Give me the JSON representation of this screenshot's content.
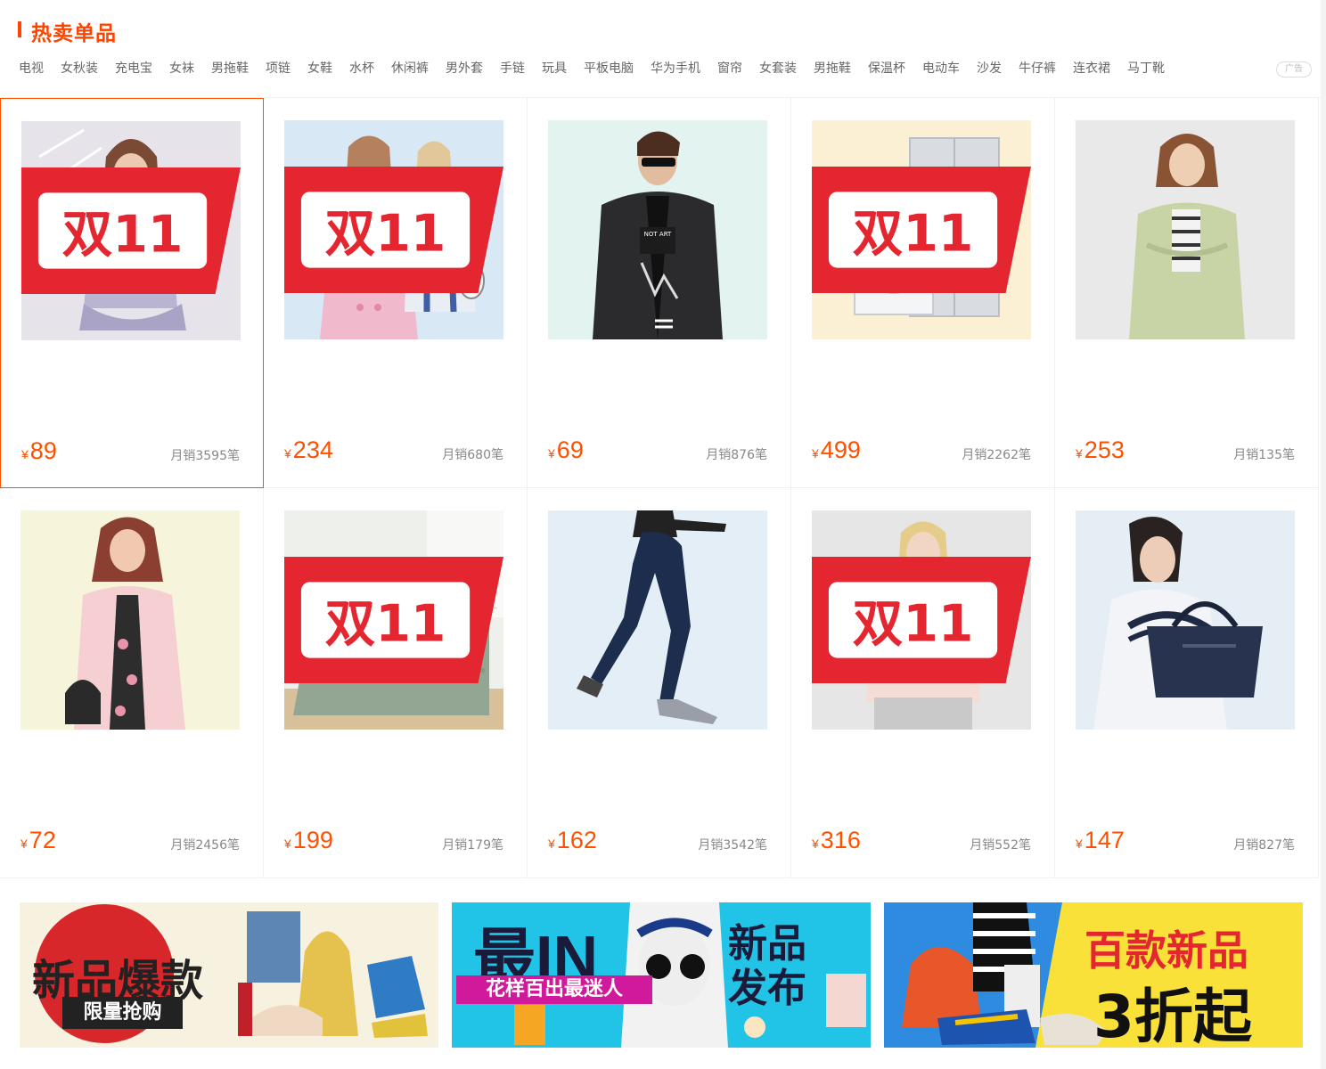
{
  "header": {
    "title": "热卖单品",
    "ad_label": "广告",
    "keywords": [
      "电视",
      "女秋装",
      "充电宝",
      "女袜",
      "男拖鞋",
      "项链",
      "女鞋",
      "水杯",
      "休闲裤",
      "男外套",
      "手链",
      "玩具",
      "平板电脑",
      "华为手机",
      "窗帘",
      "女套装",
      "男拖鞋",
      "保温杯",
      "电动车",
      "沙发",
      "牛仔裤",
      "连衣裙",
      "马丁靴"
    ]
  },
  "currency_symbol": "¥",
  "products": [
    {
      "price": "89",
      "sales": "月销3595笔",
      "tag": true,
      "image": "lavender-bow-dress"
    },
    {
      "price": "234",
      "sales": "月销680笔",
      "tag": true,
      "image": "pink-and-plaid-coats"
    },
    {
      "price": "69",
      "sales": "月销876笔",
      "tag": false,
      "image": "black-bomber-jacket"
    },
    {
      "price": "499",
      "sales": "月销2262笔",
      "tag": true,
      "image": "washer-and-fridge"
    },
    {
      "price": "253",
      "sales": "月销135笔",
      "tag": false,
      "image": "green-trench-coat"
    },
    {
      "price": "72",
      "sales": "月销2456笔",
      "tag": false,
      "image": "pink-long-coat"
    },
    {
      "price": "199",
      "sales": "月销179笔",
      "tag": true,
      "image": "sage-bedding-set"
    },
    {
      "price": "162",
      "sales": "月销3542笔",
      "tag": false,
      "image": "skinny-jeans"
    },
    {
      "price": "316",
      "sales": "月销552笔",
      "tag": true,
      "image": "pink-biker-jacket"
    },
    {
      "price": "147",
      "sales": "月销827笔",
      "tag": false,
      "image": "navy-handbag"
    }
  ],
  "banners": [
    {
      "line1": "新品爆款",
      "line2": "限量抢购"
    },
    {
      "line1": "最IN",
      "line2": "花样百出最迷人",
      "line3": "新品",
      "line4": "发布"
    },
    {
      "line1": "百款新品",
      "line2": "3折起"
    }
  ],
  "tag_label": "双11"
}
